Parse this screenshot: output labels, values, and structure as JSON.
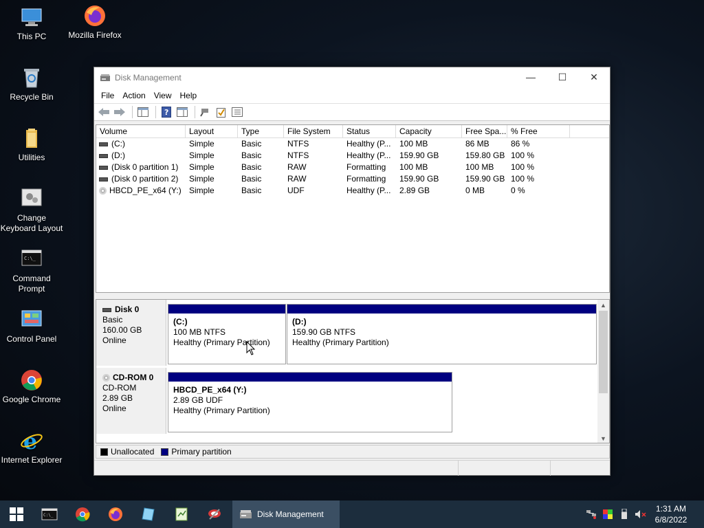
{
  "desktop": {
    "icons": [
      {
        "label": "This PC",
        "icon": "this-pc-icon"
      },
      {
        "label": "Mozilla Firefox",
        "icon": "firefox-icon"
      },
      {
        "label": "Recycle Bin",
        "icon": "recycle-bin-icon"
      },
      {
        "label": "Utilities",
        "icon": "folder-icon"
      },
      {
        "label": "Change Keyboard Layout",
        "icon": "keyboard-settings-icon"
      },
      {
        "label": "Command Prompt",
        "icon": "command-prompt-icon"
      },
      {
        "label": "Control Panel",
        "icon": "control-panel-icon"
      },
      {
        "label": "Google Chrome",
        "icon": "chrome-icon"
      },
      {
        "label": "Internet Explorer",
        "icon": "internet-explorer-icon"
      }
    ]
  },
  "window": {
    "title": "Disk Management",
    "controls": {
      "minimize": "—",
      "maximize": "☐",
      "close": "✕"
    }
  },
  "menu": [
    "File",
    "Action",
    "View",
    "Help"
  ],
  "volumes": {
    "columns": [
      "Volume",
      "Layout",
      "Type",
      "File System",
      "Status",
      "Capacity",
      "Free Spa...",
      "% Free"
    ],
    "rows": [
      {
        "volume": "(C:)",
        "layout": "Simple",
        "type": "Basic",
        "fs": "NTFS",
        "status": "Healthy (P...",
        "capacity": "100 MB",
        "free": "86 MB",
        "pct": "86 %",
        "icon": "drive"
      },
      {
        "volume": "(D:)",
        "layout": "Simple",
        "type": "Basic",
        "fs": "NTFS",
        "status": "Healthy (P...",
        "capacity": "159.90 GB",
        "free": "159.80 GB",
        "pct": "100 %",
        "icon": "drive"
      },
      {
        "volume": "(Disk 0 partition 1)",
        "layout": "Simple",
        "type": "Basic",
        "fs": "RAW",
        "status": "Formatting",
        "capacity": "100 MB",
        "free": "100 MB",
        "pct": "100 %",
        "icon": "drive"
      },
      {
        "volume": "(Disk 0 partition 2)",
        "layout": "Simple",
        "type": "Basic",
        "fs": "RAW",
        "status": "Formatting",
        "capacity": "159.90 GB",
        "free": "159.90 GB",
        "pct": "100 %",
        "icon": "drive"
      },
      {
        "volume": "HBCD_PE_x64 (Y:)",
        "layout": "Simple",
        "type": "Basic",
        "fs": "UDF",
        "status": "Healthy (P...",
        "capacity": "2.89 GB",
        "free": "0 MB",
        "pct": "0 %",
        "icon": "cd"
      }
    ]
  },
  "disks": {
    "disk0": {
      "name": "Disk 0",
      "type": "Basic",
      "size": "160.00 GB",
      "state": "Online",
      "p1": {
        "name": "(C:)",
        "size": "100 MB NTFS",
        "status": "Healthy (Primary Partition)"
      },
      "p2": {
        "name": "(D:)",
        "size": "159.90 GB NTFS",
        "status": "Healthy (Primary Partition)"
      }
    },
    "cdrom0": {
      "name": "CD-ROM 0",
      "type": "CD-ROM",
      "size": "2.89 GB",
      "state": "Online",
      "p1": {
        "name": "HBCD_PE_x64  (Y:)",
        "size": "2.89 GB UDF",
        "status": "Healthy (Primary Partition)"
      }
    }
  },
  "legend": {
    "unallocated": "Unallocated",
    "unallocated_color": "#000000",
    "primary": "Primary partition",
    "primary_color": "#000080"
  },
  "taskbar": {
    "active_app": "Disk Management",
    "time": "1:31 AM",
    "date": "6/8/2022"
  }
}
